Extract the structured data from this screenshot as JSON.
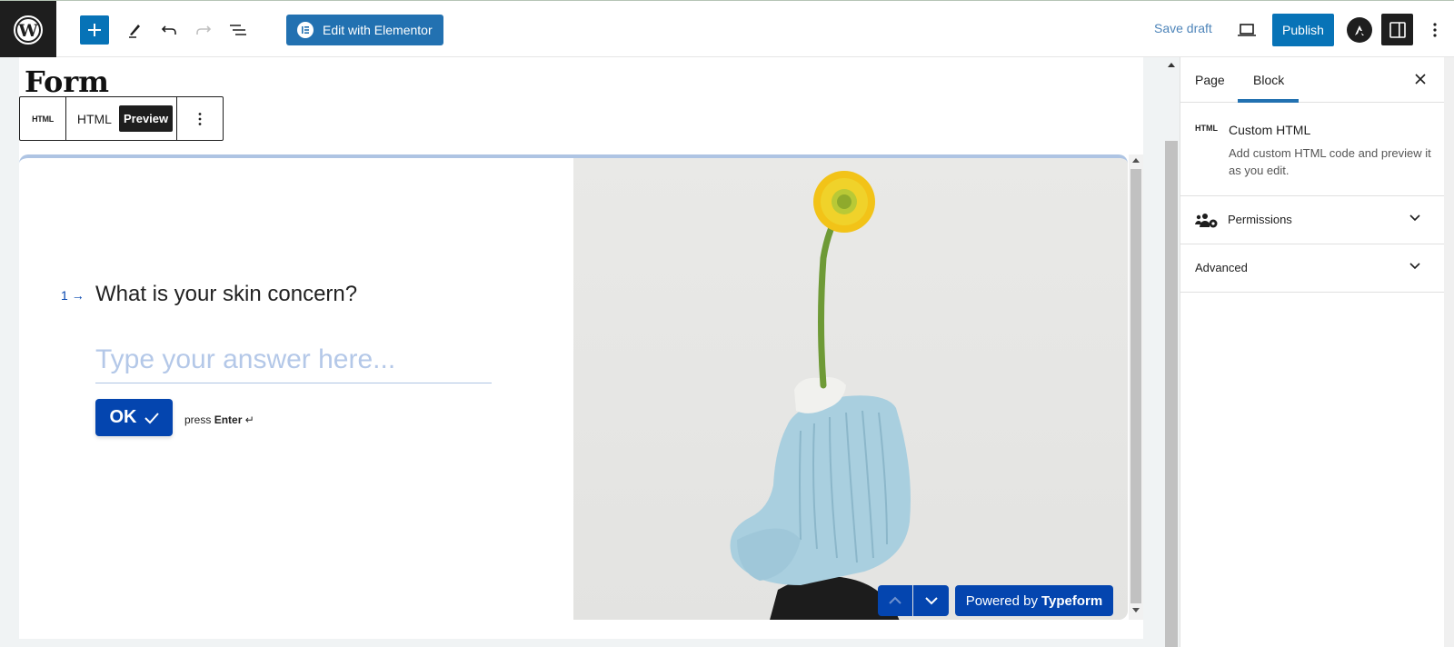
{
  "topbar": {
    "logo_icon": "wordpress-logo-icon",
    "add_block_icon": "plus-icon",
    "tools_icon": "pencil-icon",
    "undo_icon": "undo-icon",
    "redo_icon": "redo-icon",
    "list_view_icon": "list-view-icon",
    "elementor_label": "Edit with Elementor",
    "save_draft_label": "Save draft",
    "preview_icon": "laptop-icon",
    "publish_label": "Publish",
    "astra_icon": "astra-logo-icon",
    "settings_icon": "sidebar-toggle-icon",
    "options_icon": "more-vertical-icon"
  },
  "editor": {
    "page_title": "Form",
    "block_toolbar": {
      "block_type_label": "HTML",
      "html_tab": "HTML",
      "preview_tab": "Preview",
      "options_icon": "more-vertical-icon"
    }
  },
  "typeform": {
    "question_number": "1",
    "question_text": "What is your skin concern?",
    "answer_placeholder": "Type your answer here...",
    "answer_value": "",
    "ok_label": "OK",
    "press_label": "press",
    "enter_label": "Enter",
    "enter_symbol": "↵",
    "powered_by": "Powered by",
    "brand": "Typeform",
    "accent_color": "#0445af",
    "image_alt": "Yellow flower in light blue clay sculpture"
  },
  "sidebar": {
    "tabs": [
      {
        "label": "Page",
        "active": false
      },
      {
        "label": "Block",
        "active": true
      }
    ],
    "block_card": {
      "icon_label": "HTML",
      "title": "Custom HTML",
      "description": "Add custom HTML code and preview it as you edit."
    },
    "panels": [
      {
        "label": "Permissions",
        "icon": "users-gear-icon",
        "expanded": false
      },
      {
        "label": "Advanced",
        "expanded": false
      }
    ]
  }
}
